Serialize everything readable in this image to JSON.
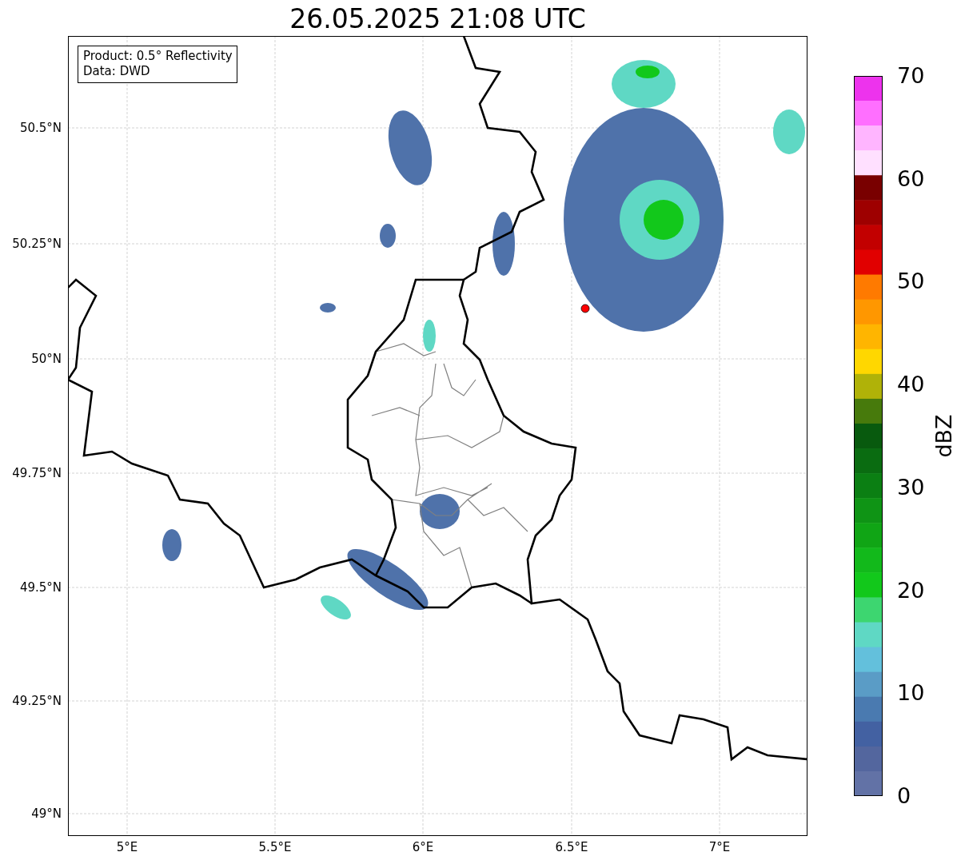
{
  "title": "26.05.2025 21:08 UTC",
  "info_box": [
    "Product: 0.5° Reflectivity",
    "Data: DWD"
  ],
  "map": {
    "lat_labels": [
      "50.5°N",
      "50.25°N",
      "50°N",
      "49.75°N",
      "49.5°N",
      "49.25°N",
      "49°N"
    ],
    "lon_labels": [
      "5°E",
      "5.5°E",
      "6°E",
      "6.5°E",
      "7°E"
    ]
  },
  "colorbar": {
    "label": "dBZ",
    "ticks": [
      "70",
      "60",
      "50",
      "40",
      "30",
      "20",
      "10",
      "0"
    ],
    "segments": [
      {
        "color": "#ed33ed"
      },
      {
        "color": "#ff6fff"
      },
      {
        "color": "#ffb5ff"
      },
      {
        "color": "#ffe0ff"
      },
      {
        "color": "#790000"
      },
      {
        "color": "#9e0000"
      },
      {
        "color": "#c20000"
      },
      {
        "color": "#e10000"
      },
      {
        "color": "#ff7a00"
      },
      {
        "color": "#ff9700"
      },
      {
        "color": "#ffb500"
      },
      {
        "color": "#ffd700"
      },
      {
        "color": "#b0b208"
      },
      {
        "color": "#477a0c"
      },
      {
        "color": "#085a0e"
      },
      {
        "color": "#0a6c11"
      },
      {
        "color": "#0b7f13"
      },
      {
        "color": "#0f9415"
      },
      {
        "color": "#10a515"
      },
      {
        "color": "#12b91b"
      },
      {
        "color": "#12c81b"
      },
      {
        "color": "#3dd670"
      },
      {
        "color": "#5fd8c4"
      },
      {
        "color": "#63c0dc"
      },
      {
        "color": "#5a9cc6"
      },
      {
        "color": "#4a7ab0"
      },
      {
        "color": "#4361a2"
      },
      {
        "color": "#53669e"
      },
      {
        "color": "#6272a6"
      }
    ]
  }
}
